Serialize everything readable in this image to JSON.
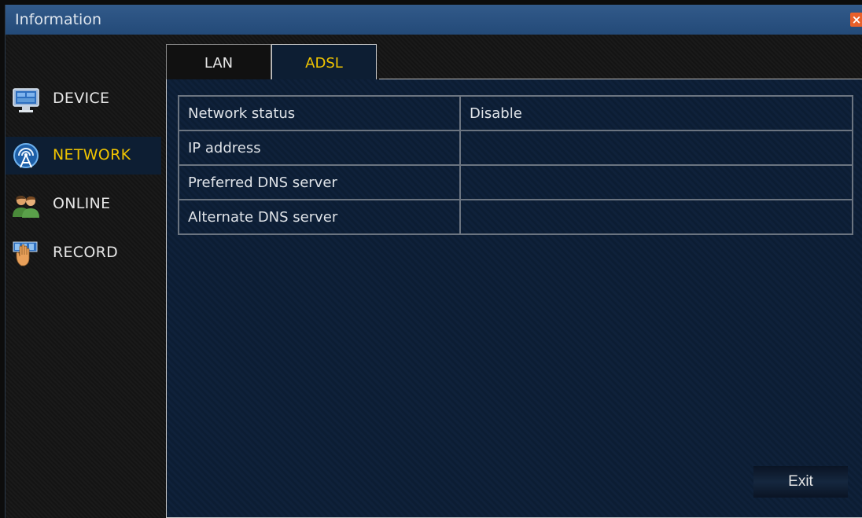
{
  "window": {
    "title": "Information"
  },
  "sidebar": {
    "items": [
      {
        "label": "DEVICE",
        "icon": "monitor-icon",
        "active": false
      },
      {
        "label": "NETWORK",
        "icon": "antenna-icon",
        "active": true
      },
      {
        "label": "ONLINE",
        "icon": "users-icon",
        "active": false
      },
      {
        "label": "RECORD",
        "icon": "record-hand-icon",
        "active": false
      }
    ]
  },
  "tabs": [
    {
      "label": "LAN",
      "active": false
    },
    {
      "label": "ADSL",
      "active": true
    }
  ],
  "table": {
    "rows": [
      {
        "key": "Network status",
        "value": "Disable"
      },
      {
        "key": "IP address",
        "value": ""
      },
      {
        "key": "Preferred DNS server",
        "value": ""
      },
      {
        "key": "Alternate DNS server",
        "value": ""
      }
    ]
  },
  "buttons": {
    "exit": "Exit"
  },
  "colors": {
    "titlebar": "#2a5282",
    "active_text": "#f0c400",
    "panel_bg": "#0c1d33",
    "close": "#e8602a"
  }
}
